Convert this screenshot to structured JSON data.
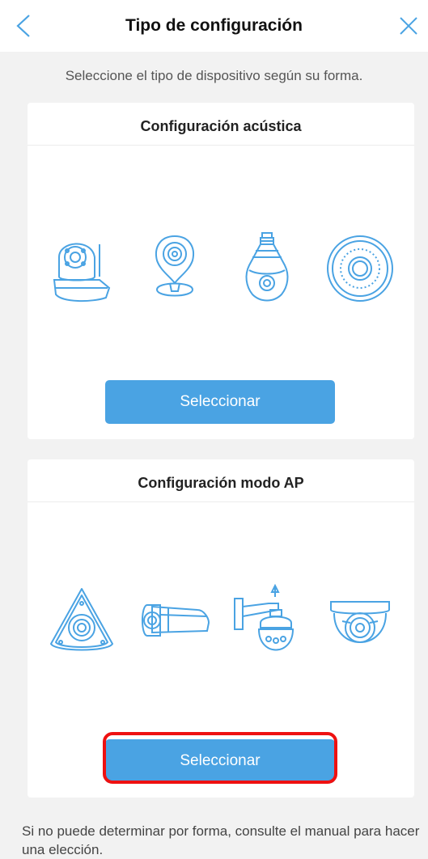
{
  "header": {
    "title": "Tipo de configuración",
    "back_icon": "chevron-left-icon",
    "close_icon": "close-icon"
  },
  "subtitle": "Seleccione el tipo de dispositivo según su forma.",
  "sections": [
    {
      "title": "Configuración acústica",
      "button_label": "Seleccionar",
      "devices": [
        "robot-camera-icon",
        "desktop-camera-icon",
        "bulb-camera-icon",
        "round-camera-icon"
      ]
    },
    {
      "title": "Configuración modo AP",
      "button_label": "Seleccionar",
      "devices": [
        "fisheye-camera-icon",
        "bullet-camera-icon",
        "ptz-camera-icon",
        "dome-camera-icon"
      ]
    }
  ],
  "footer": "Si no puede determinar por forma, consulte el manual para hacer una elección.",
  "colors": {
    "accent": "#4aa3e3",
    "highlight": "#e11111",
    "background": "#f2f2f2"
  }
}
